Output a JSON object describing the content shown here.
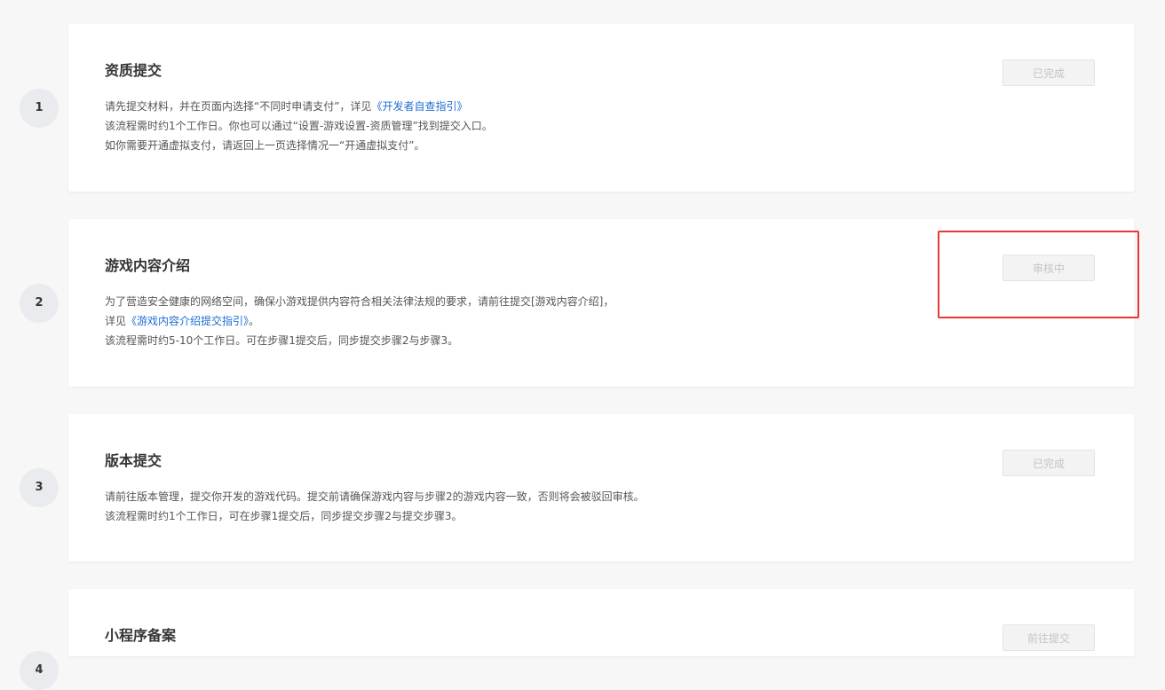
{
  "steps": [
    {
      "number": "1",
      "title": "资质提交",
      "status_label": "已完成",
      "desc": {
        "l1_text": "请先提交材料，并在页面内选择“不同时申请支付”，详见",
        "l1_link": "《开发者自查指引》",
        "l2_text": "该流程需时约1个工作日。你也可以通过“设置-游戏设置-资质管理”找到提交入口。",
        "l3_text": "如你需要开通虚拟支付，请返回上一页选择情况一“开通虚拟支付”。"
      }
    },
    {
      "number": "2",
      "title": "游戏内容介绍",
      "status_label": "审核中",
      "desc": {
        "l1_text": "为了营造安全健康的网络空间，确保小游戏提供内容符合相关法律法规的要求，请前往提交[游戏内容介绍]，",
        "l2_prefix": "详见",
        "l2_link": "《游戏内容介绍提交指引》",
        "l2_suffix": "。",
        "l3_text": "该流程需时约5-10个工作日。可在步骤1提交后，同步提交步骤2与步骤3。"
      }
    },
    {
      "number": "3",
      "title": "版本提交",
      "status_label": "已完成",
      "desc": {
        "l1_text": "请前往版本管理，提交你开发的游戏代码。提交前请确保游戏内容与步骤2的游戏内容一致，否则将会被驳回审核。",
        "l2_text": "该流程需时约1个工作日，可在步骤1提交后，同步提交步骤2与提交步骤3。"
      }
    },
    {
      "number": "4",
      "title": "小程序备案",
      "status_label": "前往提交"
    }
  ],
  "colors": {
    "link": "#1f6ed4",
    "highlight_border": "#e53935",
    "page_bg": "#f7f7f7",
    "card_bg": "#ffffff"
  }
}
